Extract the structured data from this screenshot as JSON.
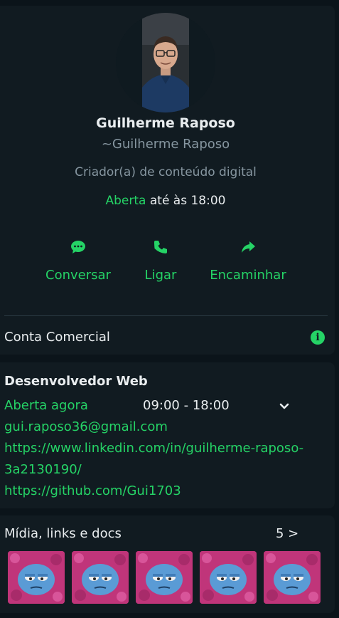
{
  "profile": {
    "name": "Guilherme Raposo",
    "push_name": "~Guilherme Raposo",
    "category": "Criador(a) de conteúdo digital",
    "status_open": "Aberta",
    "status_until": " até às 18:00"
  },
  "actions": [
    {
      "label": "Conversar",
      "icon": "chat-icon"
    },
    {
      "label": "Ligar",
      "icon": "phone-icon"
    },
    {
      "label": "Encaminhar",
      "icon": "forward-icon"
    }
  ],
  "business": {
    "label": "Conta Comercial",
    "icon": "info-icon"
  },
  "about": {
    "title": "Desenvolvedor Web",
    "open_now": "Aberta agora",
    "hours": "09:00 - 18:00",
    "email": "gui.raposo36@gmail.com",
    "linkedin_line1": "https://www.linkedin.com/in/guilherme-raposo-",
    "linkedin_line2": "3a2130190/",
    "github": "https://github.com/Gui1703"
  },
  "media": {
    "title": "Mídia, links e docs",
    "count": "5 >"
  },
  "colors": {
    "background": "#0b141a",
    "panel": "#111b21",
    "accent": "#25d366",
    "text": "#e9edef",
    "muted": "#8696a0"
  }
}
